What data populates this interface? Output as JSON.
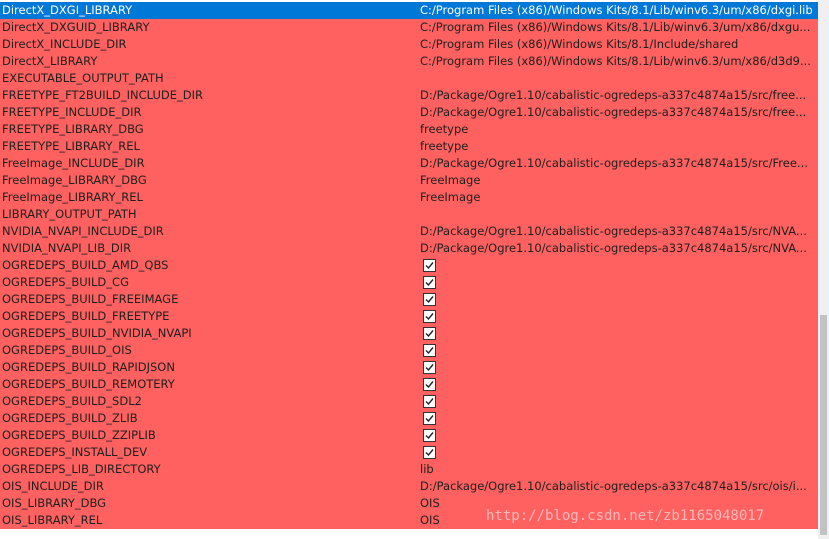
{
  "rows": [
    {
      "name": "DirectX_DXGI_LIBRARY",
      "value": "C:/Program Files (x86)/Windows Kits/8.1/Lib/winv6.3/um/x86/dxgi.lib",
      "selected": true
    },
    {
      "name": "DirectX_DXGUID_LIBRARY",
      "value": "C:/Program Files (x86)/Windows Kits/8.1/Lib/winv6.3/um/x86/dxgu..."
    },
    {
      "name": "DirectX_INCLUDE_DIR",
      "value": "C:/Program Files (x86)/Windows Kits/8.1/Include/shared"
    },
    {
      "name": "DirectX_LIBRARY",
      "value": "C:/Program Files (x86)/Windows Kits/8.1/Lib/winv6.3/um/x86/d3d9..."
    },
    {
      "name": "EXECUTABLE_OUTPUT_PATH",
      "value": ""
    },
    {
      "name": "FREETYPE_FT2BUILD_INCLUDE_DIR",
      "value": "D:/Package/Ogre1.10/cabalistic-ogredeps-a337c4874a15/src/free..."
    },
    {
      "name": "FREETYPE_INCLUDE_DIR",
      "value": "D:/Package/Ogre1.10/cabalistic-ogredeps-a337c4874a15/src/free..."
    },
    {
      "name": "FREETYPE_LIBRARY_DBG",
      "value": "freetype"
    },
    {
      "name": "FREETYPE_LIBRARY_REL",
      "value": "freetype"
    },
    {
      "name": "FreeImage_INCLUDE_DIR",
      "value": "D:/Package/Ogre1.10/cabalistic-ogredeps-a337c4874a15/src/Free..."
    },
    {
      "name": "FreeImage_LIBRARY_DBG",
      "value": "FreeImage"
    },
    {
      "name": "FreeImage_LIBRARY_REL",
      "value": "FreeImage"
    },
    {
      "name": "LIBRARY_OUTPUT_PATH",
      "value": ""
    },
    {
      "name": "NVIDIA_NVAPI_INCLUDE_DIR",
      "value": "D:/Package/Ogre1.10/cabalistic-ogredeps-a337c4874a15/src/NVA..."
    },
    {
      "name": "NVIDIA_NVAPI_LIB_DIR",
      "value": "D:/Package/Ogre1.10/cabalistic-ogredeps-a337c4874a15/src/NVA..."
    },
    {
      "name": "OGREDEPS_BUILD_AMD_QBS",
      "checkbox": true,
      "checked": true
    },
    {
      "name": "OGREDEPS_BUILD_CG",
      "checkbox": true,
      "checked": true
    },
    {
      "name": "OGREDEPS_BUILD_FREEIMAGE",
      "checkbox": true,
      "checked": true
    },
    {
      "name": "OGREDEPS_BUILD_FREETYPE",
      "checkbox": true,
      "checked": true
    },
    {
      "name": "OGREDEPS_BUILD_NVIDIA_NVAPI",
      "checkbox": true,
      "checked": true
    },
    {
      "name": "OGREDEPS_BUILD_OIS",
      "checkbox": true,
      "checked": true
    },
    {
      "name": "OGREDEPS_BUILD_RAPIDJSON",
      "checkbox": true,
      "checked": true
    },
    {
      "name": "OGREDEPS_BUILD_REMOTERY",
      "checkbox": true,
      "checked": true
    },
    {
      "name": "OGREDEPS_BUILD_SDL2",
      "checkbox": true,
      "checked": true
    },
    {
      "name": "OGREDEPS_BUILD_ZLIB",
      "checkbox": true,
      "checked": true
    },
    {
      "name": "OGREDEPS_BUILD_ZZIPLIB",
      "checkbox": true,
      "checked": true
    },
    {
      "name": "OGREDEPS_INSTALL_DEV",
      "checkbox": true,
      "checked": true
    },
    {
      "name": "OGREDEPS_LIB_DIRECTORY",
      "value": "lib"
    },
    {
      "name": "OIS_INCLUDE_DIR",
      "value": "D:/Package/Ogre1.10/cabalistic-ogredeps-a337c4874a15/src/ois/i..."
    },
    {
      "name": "OIS_LIBRARY_DBG",
      "value": "OIS"
    },
    {
      "name": "OIS_LIBRARY_REL",
      "value": "OIS"
    }
  ],
  "watermark": "http://blog.csdn.net/zb1165048017",
  "colors": {
    "row_background": "#ff6060",
    "selected_background": "#0078d7",
    "selected_text": "#ffffff",
    "text": "#202020"
  }
}
